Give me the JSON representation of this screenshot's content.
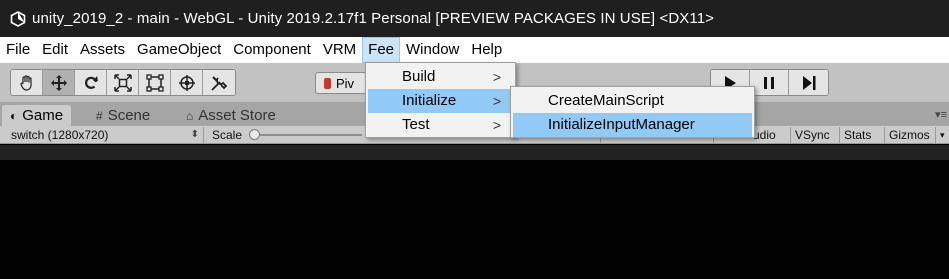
{
  "window": {
    "title": "unity_2019_2 - main - WebGL - Unity 2019.2.17f1 Personal [PREVIEW PACKAGES IN USE] <DX11>"
  },
  "menubar": {
    "items": [
      {
        "label": "File"
      },
      {
        "label": "Edit"
      },
      {
        "label": "Assets"
      },
      {
        "label": "GameObject"
      },
      {
        "label": "Component"
      },
      {
        "label": "VRM"
      },
      {
        "label": "Fee",
        "active": true
      },
      {
        "label": "Window"
      },
      {
        "label": "Help"
      }
    ]
  },
  "toolbar": {
    "tools": [
      "hand-tool-icon",
      "move-tool-icon",
      "rotate-tool-icon",
      "scale-tool-icon",
      "rect-tool-icon",
      "transform-tool-icon",
      "custom-tool-icon"
    ],
    "pivot_label": "Piv"
  },
  "tabs": [
    {
      "label": "Game",
      "icon": "game-icon",
      "active": true
    },
    {
      "label": "Scene",
      "icon": "scene-icon"
    },
    {
      "label": "Asset Store",
      "icon": "store-icon"
    }
  ],
  "gamebar": {
    "resolution": "switch (1280x720)",
    "scale_label": "Scale",
    "audio_label": "udio",
    "vsync_label": "VSync",
    "stats_label": "Stats",
    "gizmos_label": "Gizmos"
  },
  "fee_menu": {
    "items": [
      {
        "label": "Build",
        "submenu": true
      },
      {
        "label": "Initialize",
        "submenu": true,
        "highlight": true
      },
      {
        "label": "Test",
        "submenu": true
      }
    ],
    "chevron": ">"
  },
  "initialize_menu": {
    "items": [
      {
        "label": "CreateMainScript"
      },
      {
        "label": "InitializeInputManager",
        "highlight": true
      }
    ]
  },
  "colors": {
    "titlebar": "#1f1f1f",
    "menubar": "#ffffff",
    "toolbar": "#c2c2c2",
    "highlight": "#91c9f7",
    "game_bg": "#020202"
  }
}
